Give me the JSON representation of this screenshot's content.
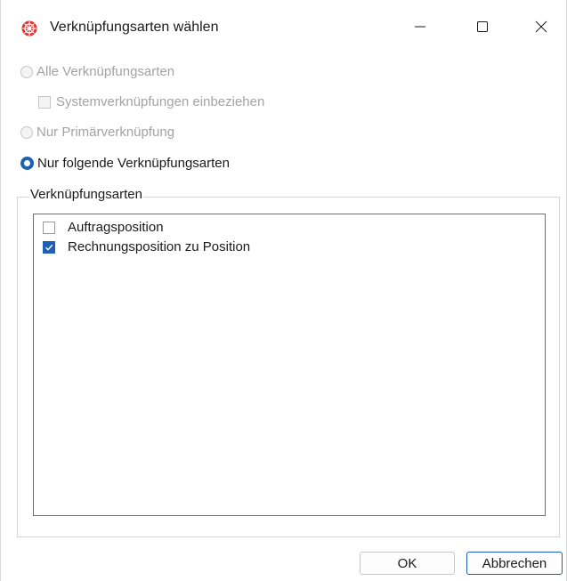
{
  "window": {
    "title": "Verknüpfungsarten wählen",
    "icons": {
      "app": "globe-app-icon",
      "minimize": "minimize-icon",
      "maximize": "maximize-icon",
      "close": "close-icon"
    }
  },
  "options": {
    "all_types": {
      "label": "Alle Verknüpfungsarten",
      "selected": false,
      "enabled": false
    },
    "include_system": {
      "label": "Systemverknüpfungen einbeziehen",
      "checked": false,
      "enabled": false
    },
    "primary_only": {
      "label": "Nur Primärverknüpfung",
      "selected": false,
      "enabled": false
    },
    "following_types": {
      "label": "Nur folgende Verknüpfungsarten",
      "selected": true,
      "enabled": true
    }
  },
  "group": {
    "title": "Verknüpfungsarten",
    "items": [
      {
        "label": "Auftragsposition",
        "checked": false
      },
      {
        "label": "Rechnungsposition zu Position",
        "checked": true
      }
    ]
  },
  "buttons": {
    "ok": "OK",
    "cancel": "Abbrechen"
  },
  "colors": {
    "accent": "#1f5fb4",
    "disabled_text": "#a3a3a3"
  }
}
